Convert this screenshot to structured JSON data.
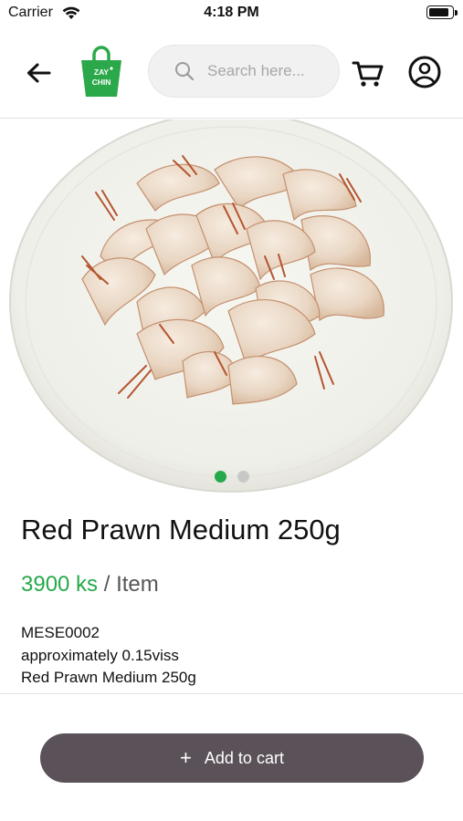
{
  "status_bar": {
    "carrier": "Carrier",
    "time": "4:18 PM",
    "battery_level": 0.9
  },
  "header": {
    "logo_text_line1": "ZAY",
    "logo_text_line2": "CHIN",
    "search_placeholder": "Search here..."
  },
  "carousel": {
    "active_index": 0,
    "total": 2
  },
  "product": {
    "title": "Red Prawn Medium 250g",
    "price": "3900 ks",
    "unit": " / Item",
    "sku": "MESE0002",
    "weight_note": "approximately 0.15viss",
    "name_repeat": "Red Prawn Medium 250g"
  },
  "actions": {
    "add_to_cart_label": "Add to cart"
  },
  "colors": {
    "accent_green": "#25a94a",
    "button_dark": "#5a5258"
  }
}
